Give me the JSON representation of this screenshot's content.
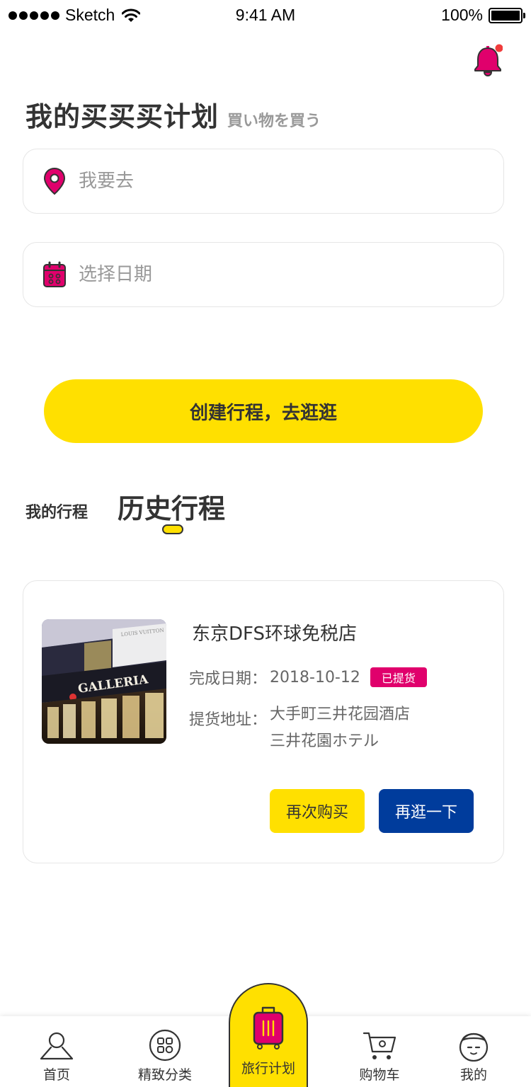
{
  "status_bar": {
    "carrier": "Sketch",
    "time": "9:41 AM",
    "battery": "100%"
  },
  "header": {
    "title": "我的买买买计划",
    "subtitle": "買い物を買う"
  },
  "form": {
    "destination": {
      "placeholder": "我要去",
      "value": ""
    },
    "date": {
      "placeholder": "选择日期",
      "value": ""
    },
    "submit_label": "创建行程，去逛逛"
  },
  "tabs": {
    "mine_label": "我的行程",
    "history_label": "历史行程"
  },
  "trip_card": {
    "store_name": "东京DFS环球免税店",
    "date_label": "完成日期：",
    "date_value": "2018-10-12",
    "status_badge": "已提货",
    "address_label": "提货地址：",
    "address_line1": "大手町三井花园酒店",
    "address_line2": "三井花園ホテル",
    "image_sign": "GALLERIA",
    "image_banner": "LOUIS VUITTON",
    "rebuy_label": "再次购买",
    "revisit_label": "再逛一下"
  },
  "tab_bar": {
    "items": [
      {
        "label": "首页",
        "icon": "home-icon"
      },
      {
        "label": "精致分类",
        "icon": "category-icon"
      },
      {
        "label": "旅行计划",
        "icon": "suitcase-icon",
        "active": true
      },
      {
        "label": "购物车",
        "icon": "cart-icon"
      },
      {
        "label": "我的",
        "icon": "profile-icon"
      }
    ]
  },
  "colors": {
    "accent_yellow": "#ffe000",
    "brand_magenta": "#e0006c",
    "brand_blue": "#003c9c",
    "notification_dot": "#f03c3c"
  }
}
